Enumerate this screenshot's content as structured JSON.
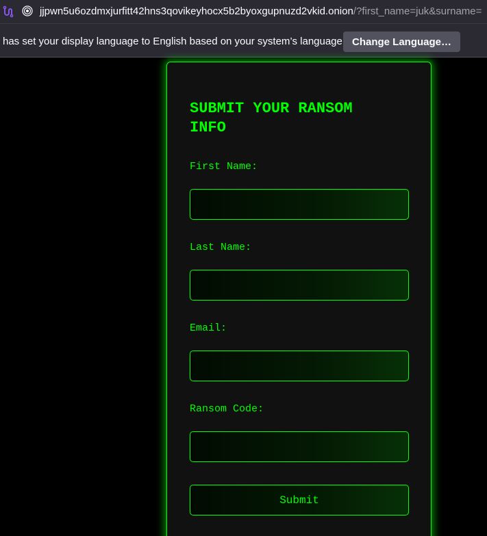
{
  "browser": {
    "url_host": "jjpwn5u6ozdmxjurfitt42hns3qovikeyhocx5b2byoxgupnuzd2vkid.onion",
    "url_rest": "/?first_name=juk&surname=",
    "circuit_icon": "tor-circuit-icon",
    "site_icon": "onion-icon"
  },
  "notification": {
    "text": "has set your display language to English based on your system’s language.",
    "button_label": "Change Language…"
  },
  "form": {
    "title": "SUBMIT YOUR RANSOM INFO",
    "fields": [
      {
        "label": "First Name:",
        "value": ""
      },
      {
        "label": "Last Name:",
        "value": ""
      },
      {
        "label": "Email:",
        "value": ""
      },
      {
        "label": "Ransom Code:",
        "value": ""
      }
    ],
    "submit_label": "Submit"
  },
  "colors": {
    "accent": "#00ff00",
    "card_bg": "#111111",
    "page_bg": "#000000",
    "chrome_bg": "#2b2a33"
  }
}
